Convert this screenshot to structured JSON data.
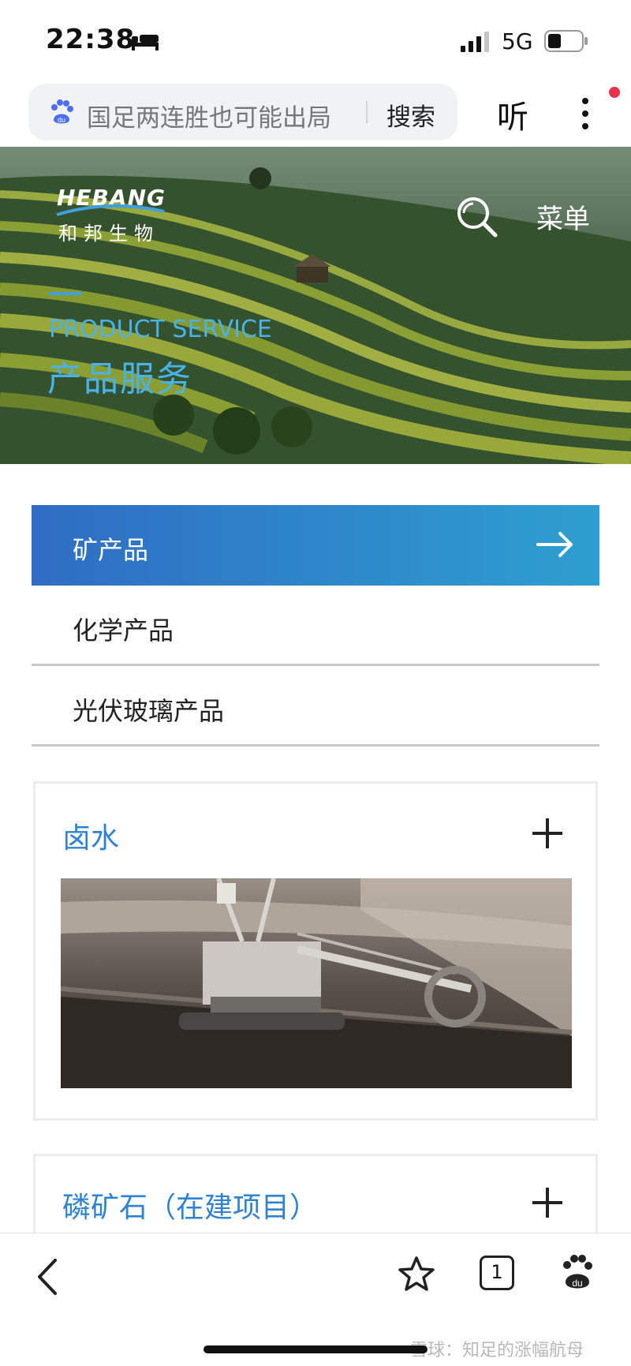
{
  "status_bar": {
    "time": "22:38",
    "network": "5G"
  },
  "browser": {
    "search_query": "国足两连胜也可能出局",
    "search_button": "搜索",
    "listen_button": "听"
  },
  "hero": {
    "logo_text": "HEBANG",
    "logo_cn": "和邦生物",
    "menu_label": "菜单",
    "subtitle_en": "PRODUCT SERVICE",
    "title_cn": "产品服务"
  },
  "categories": [
    {
      "label": "矿产品",
      "active": true
    },
    {
      "label": "化学产品",
      "active": false
    },
    {
      "label": "光伏玻璃产品",
      "active": false
    }
  ],
  "cards": [
    {
      "title": "卤水"
    },
    {
      "title": "磷矿石（在建项目）"
    }
  ],
  "bottom_nav": {
    "tabs_count": "1",
    "watermark": "雪球：知足的涨幅航母"
  },
  "colors": {
    "accent_blue": "#2f83cf",
    "active_gradient_start": "#2f6dc4",
    "active_gradient_end": "#2e9fd0"
  }
}
